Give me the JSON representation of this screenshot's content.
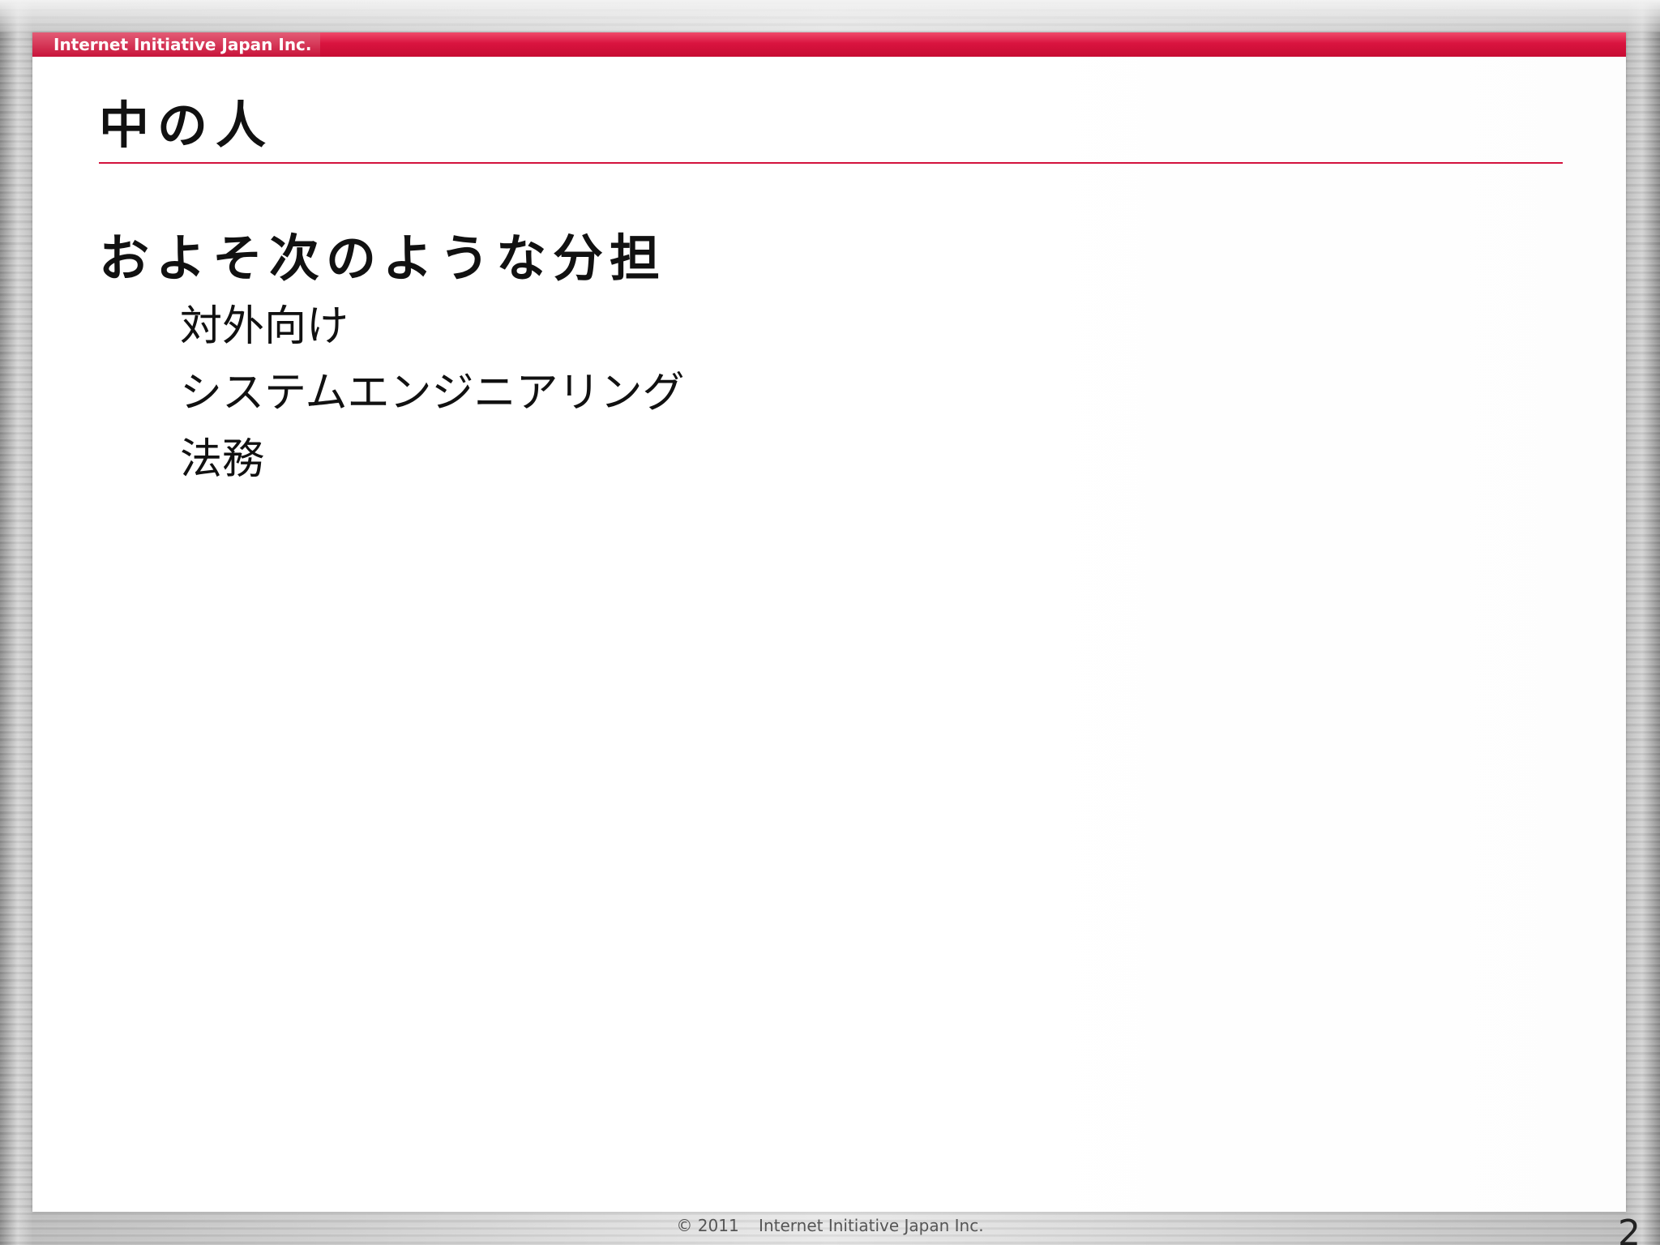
{
  "header": {
    "company": "Internet Initiative Japan Inc."
  },
  "slide": {
    "title": "中の人",
    "lead": "およそ次のような分担",
    "items": [
      {
        "text": "対外向け"
      },
      {
        "text": "システムエンジニアリング"
      },
      {
        "text": "法務"
      }
    ]
  },
  "footer": {
    "copyright_mark": "©",
    "year": "2011",
    "company": "Internet Initiative Japan Inc.",
    "page_number": "2"
  },
  "colors": {
    "accent": "#d3123d",
    "text": "#111111"
  }
}
